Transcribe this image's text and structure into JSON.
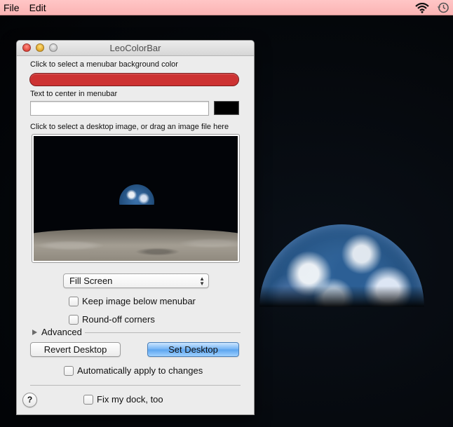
{
  "menubar": {
    "items": [
      "File",
      "Edit"
    ],
    "background_color": "#fbb4b4",
    "status_icons": [
      "wifi-icon",
      "time-machine-icon"
    ]
  },
  "window": {
    "title": "LeoColorBar",
    "menubar_color_label": "Click to select a menubar background color",
    "menubar_color": "#cd3232",
    "center_text_label": "Text to center in menubar",
    "center_text_value": "",
    "text_color": "#000000",
    "desktop_image_label": "Click to select a desktop image, or drag an image file here",
    "scaling_popup": {
      "selected": "Fill Screen"
    },
    "keep_below_menubar": {
      "label": "Keep image below menubar",
      "checked": false
    },
    "round_corners": {
      "label": "Round-off corners",
      "checked": false
    },
    "advanced_label": "Advanced",
    "revert_button": "Revert Desktop",
    "set_button": "Set Desktop",
    "auto_apply": {
      "label": "Automatically apply to changes",
      "checked": false
    },
    "help_label": "?",
    "fix_dock": {
      "label": "Fix my dock, too",
      "checked": false
    }
  }
}
